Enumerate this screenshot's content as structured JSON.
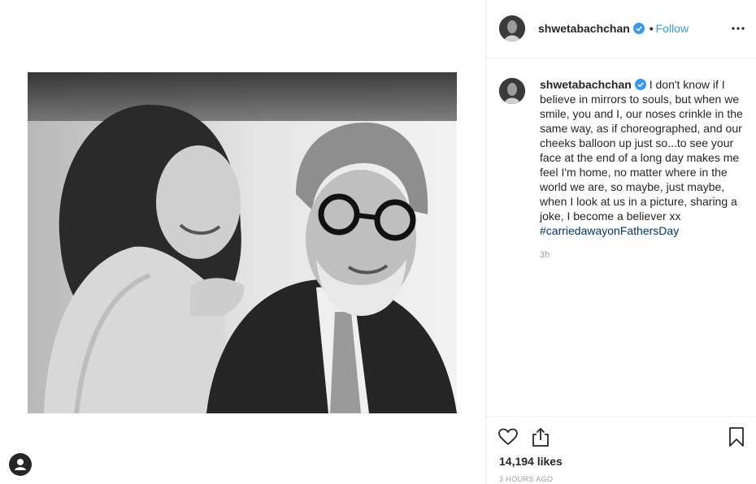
{
  "post": {
    "username": "shwetabachchan",
    "follow_separator": "•",
    "follow_label": "Follow",
    "caption_text": "I don't know if I believe in mirrors to souls, but when we smile, you and I, our noses crinkle in the same way, as if choreographed, and our cheeks balloon up just so...to see your face at the end of a long day makes me feel I'm home, no matter where in the world we are, so maybe, just maybe, when I look at us in a picture, sharing a joke, I become a believer xx ",
    "hashtag": "#carriedawayonFathersDay",
    "relative_time": "3h",
    "likes": "14,194 likes",
    "post_time": "3 HOURS AGO"
  },
  "icons": {
    "verified": "verified-badge-icon",
    "more": "more-options-icon",
    "like": "heart-icon",
    "share": "share-icon",
    "save": "bookmark-icon",
    "profile": "user-profile-icon"
  },
  "colors": {
    "link_blue": "#3897f0",
    "hashtag": "#003569",
    "muted": "#999999",
    "text": "#262626"
  }
}
